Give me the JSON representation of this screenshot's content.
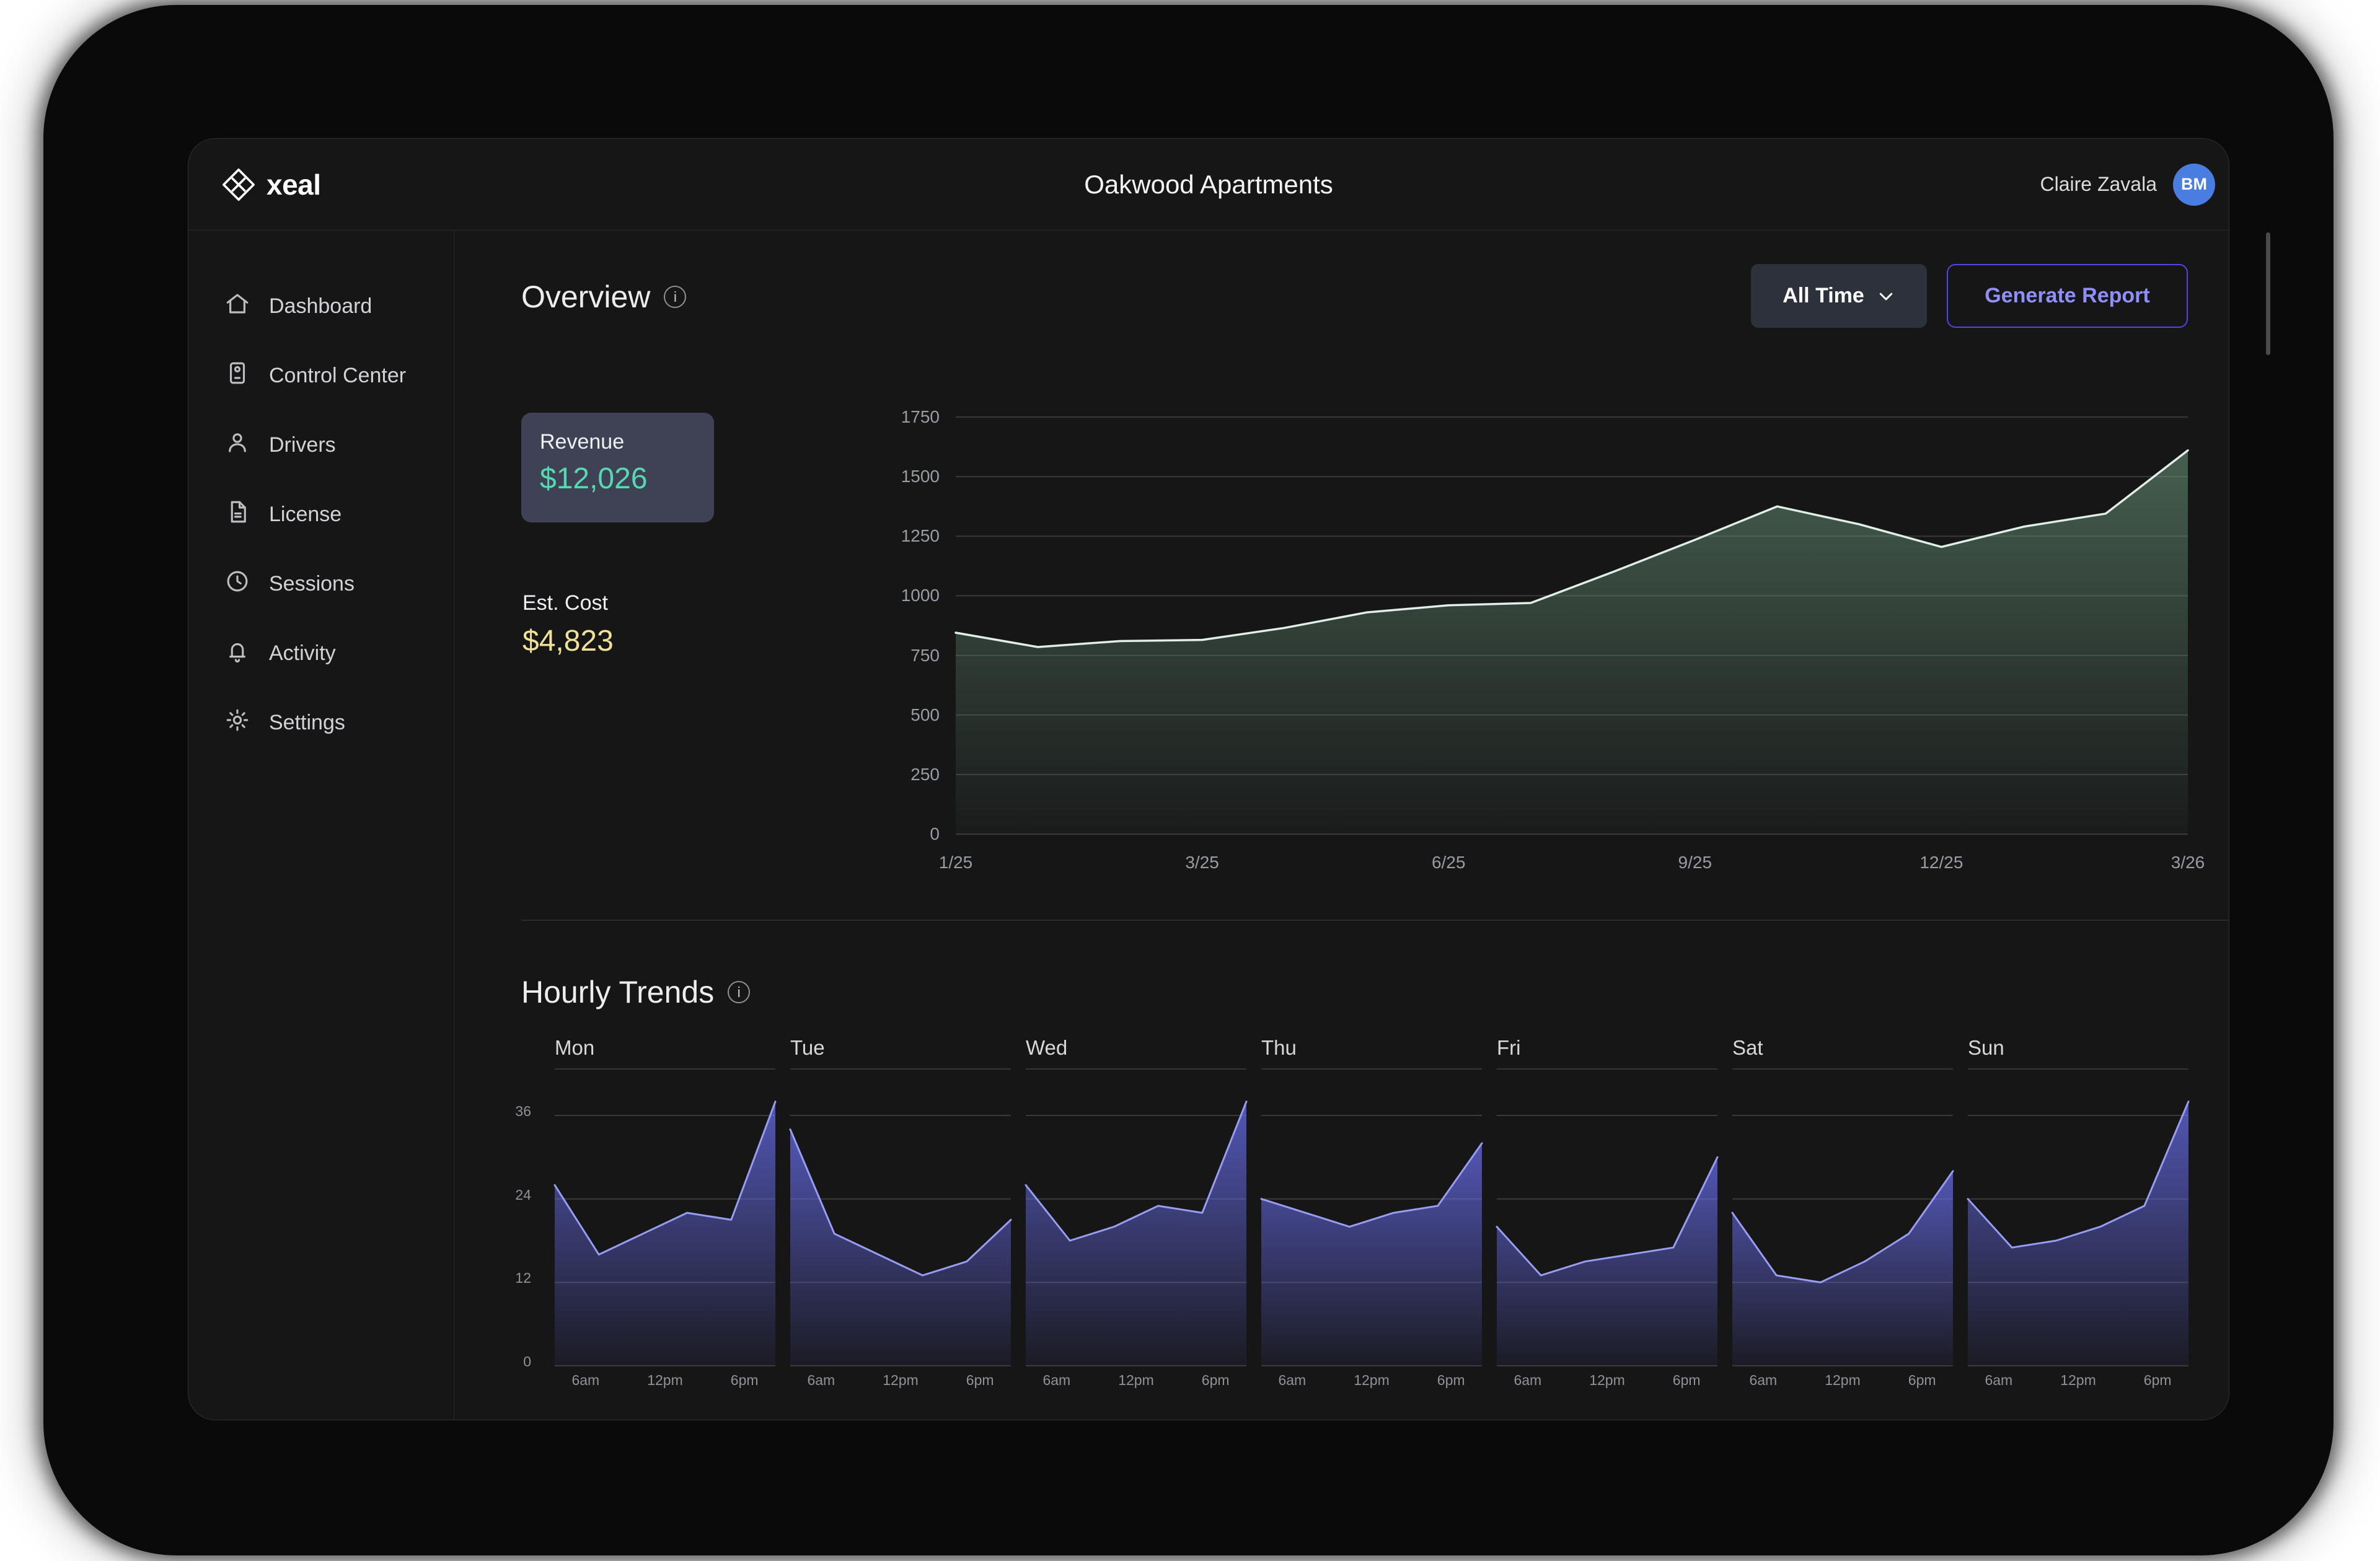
{
  "header": {
    "logo_text": "xeal",
    "title": "Oakwood Apartments",
    "user_name": "Claire Zavala",
    "avatar_initials": "BM"
  },
  "sidebar": {
    "items": [
      {
        "label": "Dashboard",
        "icon": "home-icon"
      },
      {
        "label": "Control Center",
        "icon": "control-center-icon"
      },
      {
        "label": "Drivers",
        "icon": "drivers-icon"
      },
      {
        "label": "License",
        "icon": "license-icon"
      },
      {
        "label": "Sessions",
        "icon": "clock-icon"
      },
      {
        "label": "Activity",
        "icon": "bell-icon"
      },
      {
        "label": "Settings",
        "icon": "gear-icon"
      }
    ]
  },
  "overview": {
    "title": "Overview",
    "time_filter_label": "All Time",
    "generate_report_label": "Generate Report",
    "revenue_label": "Revenue",
    "revenue_value": "$12,026",
    "est_cost_label": "Est. Cost",
    "est_cost_value": "$4,823"
  },
  "hourly": {
    "title": "Hourly Trends"
  },
  "colors": {
    "accent_indigo_border": "#4F46E5",
    "accent_indigo_text": "#8F8FFA",
    "revenue_teal": "#57D8B2",
    "cost_yellow": "#EFE296",
    "avatar_blue": "#4A7DE0",
    "card_bg": "#3E4254",
    "app_bg": "#161617"
  },
  "chart_data": [
    {
      "id": "revenue-trend",
      "type": "area",
      "ylim": [
        0,
        1750
      ],
      "yticks": [
        0,
        250,
        500,
        750,
        1000,
        1250,
        1500,
        1750
      ],
      "x_tick_labels": [
        "1/25",
        "3/25",
        "6/25",
        "9/25",
        "12/25",
        "3/26"
      ],
      "x_tick_indices": [
        0,
        3,
        6,
        9,
        12,
        15
      ],
      "values": [
        845,
        785,
        810,
        815,
        865,
        930,
        960,
        970,
        1100,
        1235,
        1375,
        1300,
        1205,
        1290,
        1345,
        1610
      ],
      "line_color": "#dfeee6",
      "fill_color": "#6d9a7e",
      "grid": true,
      "legend": false
    },
    {
      "id": "hourly-trends",
      "type": "area-small-multiples",
      "ylim": [
        0,
        38.5
      ],
      "yticks": [
        0,
        12,
        24,
        36
      ],
      "x_tick_labels": [
        "6am",
        "12pm",
        "6pm"
      ],
      "x_tick_fractions": [
        0.14,
        0.5,
        0.86
      ],
      "categories": [
        "Mon",
        "Tue",
        "Wed",
        "Thu",
        "Fri",
        "Sat",
        "Sun"
      ],
      "series": [
        {
          "name": "Mon",
          "values": [
            26,
            16,
            19,
            22,
            21,
            38
          ]
        },
        {
          "name": "Tue",
          "values": [
            34,
            19,
            16,
            13,
            15,
            21
          ]
        },
        {
          "name": "Wed",
          "values": [
            26,
            18,
            20,
            23,
            22,
            38
          ]
        },
        {
          "name": "Thu",
          "values": [
            24,
            22,
            20,
            22,
            23,
            32
          ]
        },
        {
          "name": "Fri",
          "values": [
            20,
            13,
            15,
            16,
            17,
            30
          ]
        },
        {
          "name": "Sat",
          "values": [
            22,
            13,
            12,
            15,
            19,
            28
          ]
        },
        {
          "name": "Sun",
          "values": [
            24,
            17,
            18,
            20,
            23,
            38
          ]
        }
      ],
      "line_color": "#989df4",
      "fill_color": "#6a6ff0",
      "grid": true,
      "legend": false
    }
  ]
}
